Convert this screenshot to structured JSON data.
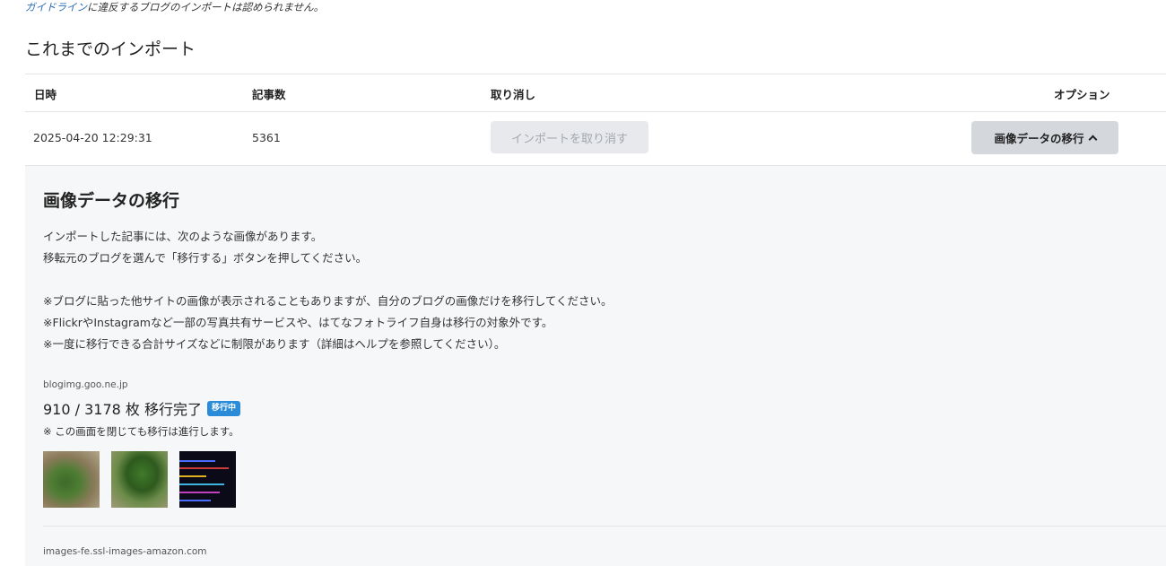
{
  "notice": {
    "link_text": "ガイドライン",
    "rest_text": "に違反するブログのインポートは認められません。"
  },
  "section_title": "これまでのインポート",
  "table": {
    "headers": {
      "datetime": "日時",
      "count": "記事数",
      "cancel": "取り消し",
      "options": "オプション"
    },
    "rows": [
      {
        "datetime": "2025-04-20 12:29:31",
        "count": "5361",
        "cancel_label": "インポートを取り消す",
        "option_label": "画像データの移行"
      }
    ]
  },
  "panel": {
    "title": "画像データの移行",
    "intro": [
      "インポートした記事には、次のような画像があります。",
      "移転元のブログを選んで「移行する」ボタンを押してください。"
    ],
    "notes": [
      "※ブログに貼った他サイトの画像が表示されることもありますが、自分のブログの画像だけを移行してください。",
      "※FlickrやInstagramなど一部の写真共有サービスや、はてなフォトライフ自身は移行の対象外です。",
      "※一度に移行できる合計サイズなどに制限があります（詳細はヘルプを参照してください）。"
    ],
    "sources": [
      {
        "host": "blogimg.goo.ne.jp",
        "progress": "910 / 3178 枚 移行完了",
        "status_badge": "移行中",
        "close_note": "※ この画面を閉じても移行は進行します。"
      },
      {
        "host": "images-fe.ssl-images-amazon.com"
      }
    ]
  },
  "colors": {
    "link": "#2a6db3",
    "badge": "#2a8cd8",
    "panel_bg": "#f6f7f8",
    "button_bg": "#d4d8dd"
  },
  "icons": {
    "option_toggle": "chevron-up-icon"
  }
}
